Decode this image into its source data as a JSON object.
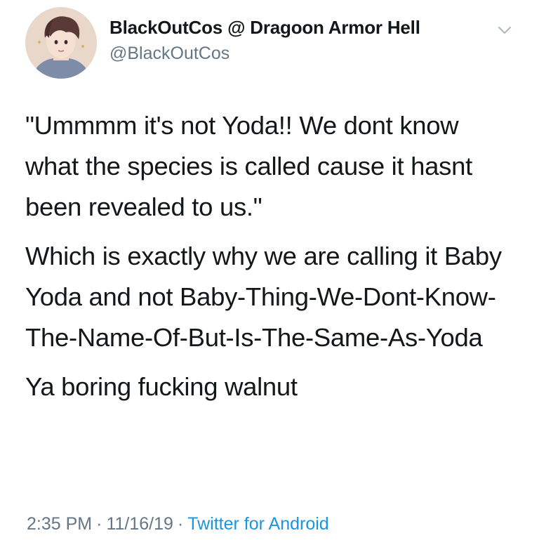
{
  "user": {
    "display_name": "BlackOutCos @ Dragoon Armor Hell",
    "handle": "@BlackOutCos",
    "avatar_icon": "illustrated-avatar"
  },
  "header": {
    "menu_icon": "chevron-down-icon"
  },
  "tweet": {
    "paragraphs": [
      "\"Ummmm it's not Yoda!! We dont know what the species is called cause it hasnt been revealed to us.\"",
      "Which is exactly why we are calling it Baby Yoda and not Baby-Thing-We-Dont-Know-The-Name-Of-But-Is-The-Same-As-Yoda",
      "Ya boring fucking walnut"
    ]
  },
  "meta": {
    "time": "2:35 PM",
    "separator": "·",
    "date": "11/16/19",
    "source": "Twitter for Android"
  },
  "colors": {
    "text": "#14171a",
    "secondary": "#657786",
    "link": "#1b95e0"
  }
}
